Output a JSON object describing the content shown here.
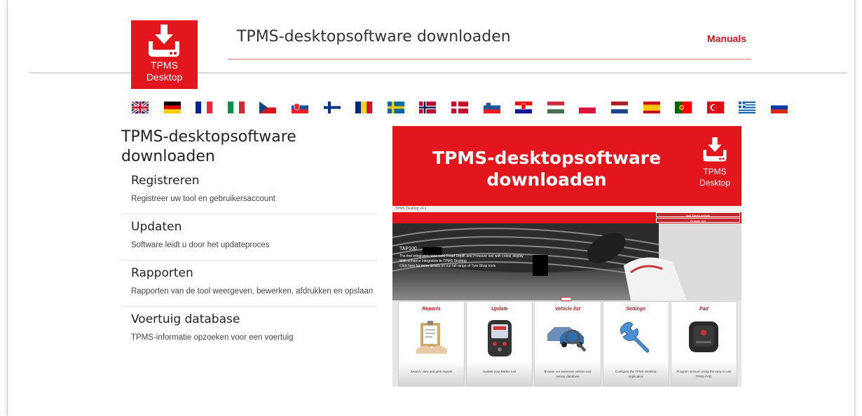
{
  "header": {
    "logo_line1": "TPMS",
    "logo_line2": "Desktop",
    "title": "TPMS-desktopsoftware downloaden",
    "manuals_link": "Manuals",
    "accent_color": "#e3161d"
  },
  "languages": [
    {
      "code": "en",
      "icon": "flag-uk-icon"
    },
    {
      "code": "de",
      "icon": "flag-germany-icon"
    },
    {
      "code": "fr",
      "icon": "flag-france-icon"
    },
    {
      "code": "it",
      "icon": "flag-italy-icon"
    },
    {
      "code": "cs",
      "icon": "flag-czech-icon"
    },
    {
      "code": "sk",
      "icon": "flag-slovakia-icon"
    },
    {
      "code": "fi",
      "icon": "flag-finland-icon"
    },
    {
      "code": "ro",
      "icon": "flag-romania-icon"
    },
    {
      "code": "sv",
      "icon": "flag-sweden-icon"
    },
    {
      "code": "no",
      "icon": "flag-norway-icon"
    },
    {
      "code": "da",
      "icon": "flag-denmark-icon"
    },
    {
      "code": "sl",
      "icon": "flag-slovenia-icon"
    },
    {
      "code": "hr",
      "icon": "flag-croatia-icon"
    },
    {
      "code": "hu",
      "icon": "flag-hungary-icon"
    },
    {
      "code": "pl",
      "icon": "flag-poland-icon"
    },
    {
      "code": "nl",
      "icon": "flag-netherlands-icon"
    },
    {
      "code": "es",
      "icon": "flag-spain-icon"
    },
    {
      "code": "pt",
      "icon": "flag-portugal-icon"
    },
    {
      "code": "tr",
      "icon": "flag-turkey-icon"
    },
    {
      "code": "el",
      "icon": "flag-greece-icon"
    },
    {
      "code": "ru",
      "icon": "flag-russia-icon"
    }
  ],
  "main": {
    "heading": "TPMS-desktopsoftware downloaden",
    "features": [
      {
        "title": "Registreren",
        "desc": "Registreer uw tool en gebruikersaccount"
      },
      {
        "title": "Updaten",
        "desc": "Software leidt u door het updateproces"
      },
      {
        "title": "Rapporten",
        "desc": "Rapporten van de tool weergeven, bewerken, afdrukken en opslaan"
      },
      {
        "title": "Voertuig database",
        "desc": "TPMS-informatie opzoeken voor een voertuig"
      }
    ]
  },
  "promo": {
    "title_line1": "TPMS-desktopsoftware",
    "title_line2": "downloaden",
    "logo_line1": "TPMS",
    "logo_line2": "Desktop",
    "app": {
      "window_title": "TPMS Desktop v4.1",
      "btn_1": "Visit Bartec website",
      "btn_2": "Register tool",
      "hero_heading": "TAP100",
      "hero_line1": "The first integrated hand held Tread Depth and Pressure tool with colour display",
      "hero_line2": "With enhance integration to TPMS Desktop",
      "hero_line3": "Click here for more details on our full range of Tyre Shop tools",
      "tiles": [
        {
          "label": "Reports",
          "desc": "Search, view and print reports",
          "icon": "reports-icon"
        },
        {
          "label": "Update",
          "desc": "Update your Bartec tool",
          "icon": "update-tool-icon"
        },
        {
          "label": "Vehicle list",
          "desc": "Browse our extensive vehicle and sensor database",
          "icon": "vehicle-list-icon"
        },
        {
          "label": "Settings",
          "desc": "Configure the TPMS Desktop Application",
          "icon": "wrench-icon"
        },
        {
          "label": "Pad",
          "desc": "Program sensors using the easy to use TPMS PAD.",
          "icon": "pad-icon"
        }
      ]
    }
  }
}
